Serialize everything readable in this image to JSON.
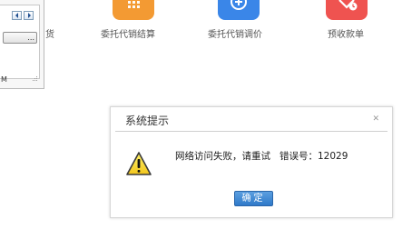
{
  "left_panel": {
    "button_label": "...",
    "footer_text": "M"
  },
  "apps": [
    {
      "label": "货",
      "icon": "partial-hidden-icon"
    },
    {
      "label": "委托代销结算",
      "icon": "grid-calculator-icon",
      "color": "#f39a33"
    },
    {
      "label": "委托代销调价",
      "icon": "plus-circle-icon",
      "color": "#3a86e8"
    },
    {
      "label": "预收款单",
      "icon": "receipt-clock-icon",
      "color": "#ef5350"
    }
  ],
  "dialog": {
    "title": "系统提示",
    "close_glyph": "✕",
    "message": "网络访问失败，请重试",
    "error_label": "错误号：12029",
    "ok_label": "确定",
    "icon": "warning-triangle-icon"
  }
}
